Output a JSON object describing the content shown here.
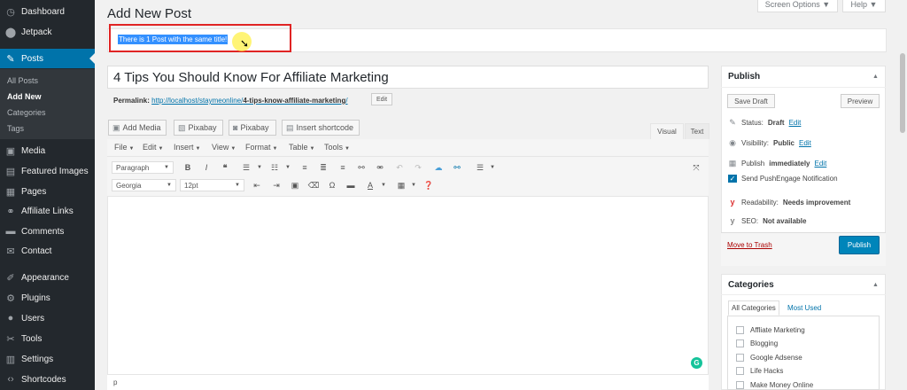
{
  "sidebar": {
    "items": [
      {
        "label": "Dashboard",
        "icon": "dashboard-icon",
        "glyph": "◷"
      },
      {
        "label": "Jetpack",
        "icon": "jetpack-icon",
        "glyph": "⬤"
      },
      {
        "label": "Posts",
        "icon": "pin-icon",
        "glyph": "✎"
      },
      {
        "label": "Media",
        "icon": "media-icon",
        "glyph": "▣"
      },
      {
        "label": "Featured Images",
        "icon": "images-icon",
        "glyph": "▤"
      },
      {
        "label": "Pages",
        "icon": "pages-icon",
        "glyph": "▦"
      },
      {
        "label": "Affiliate Links",
        "icon": "link-icon",
        "glyph": "⚭"
      },
      {
        "label": "Comments",
        "icon": "comments-icon",
        "glyph": "▬"
      },
      {
        "label": "Contact",
        "icon": "contact-icon",
        "glyph": "✉"
      },
      {
        "label": "Appearance",
        "icon": "appearance-icon",
        "glyph": "✐"
      },
      {
        "label": "Plugins",
        "icon": "plugins-icon",
        "glyph": "⚙"
      },
      {
        "label": "Users",
        "icon": "users-icon",
        "glyph": "●"
      },
      {
        "label": "Tools",
        "icon": "tools-icon",
        "glyph": "✂"
      },
      {
        "label": "Settings",
        "icon": "settings-icon",
        "glyph": "▥"
      },
      {
        "label": "Shortcodes",
        "icon": "shortcodes-icon",
        "glyph": "‹›"
      }
    ],
    "submenu": [
      "All Posts",
      "Add New",
      "Categories",
      "Tags"
    ]
  },
  "top": {
    "screen_options": "Screen Options ▼",
    "help": "Help ▼"
  },
  "page_title": "Add New Post",
  "notice": "There is 1 Post with the same title!",
  "post": {
    "title": "4 Tips You Should Know For Affiliate Marketing",
    "permalink_label": "Permalink:",
    "permalink_base": "http://localhost/staymeonline/",
    "permalink_slug": "4-tips-know-affiliate-marketing",
    "permalink_end": "/",
    "permalink_edit": "Edit"
  },
  "media_buttons": [
    "Add Media",
    "Pixabay",
    "Pixabay",
    "Insert shortcode"
  ],
  "editor_tabs": {
    "visual": "Visual",
    "text": "Text"
  },
  "menubar": [
    "File",
    "Edit",
    "Insert",
    "View",
    "Format",
    "Table",
    "Tools"
  ],
  "toolbar": {
    "format": "Paragraph",
    "font": "Georgia",
    "size": "12pt"
  },
  "status_path": "p",
  "publish": {
    "title": "Publish",
    "save_draft": "Save Draft",
    "preview": "Preview",
    "status_label": "Status:",
    "status_value": "Draft",
    "visibility_label": "Visibility:",
    "visibility_value": "Public",
    "publish_label": "Publish",
    "publish_value": "immediately",
    "edit": "Edit",
    "push": "Send PushEngage Notification",
    "readability_label": "Readability:",
    "readability_value": "Needs improvement",
    "seo_label": "SEO:",
    "seo_value": "Not available",
    "trash": "Move to Trash",
    "publish_button": "Publish"
  },
  "categories": {
    "title": "Categories",
    "tab_all": "All Categories",
    "tab_used": "Most Used",
    "items": [
      "Affliate Marketing",
      "Blogging",
      "Google Adsense",
      "Life Hacks",
      "Make Money Online"
    ]
  }
}
